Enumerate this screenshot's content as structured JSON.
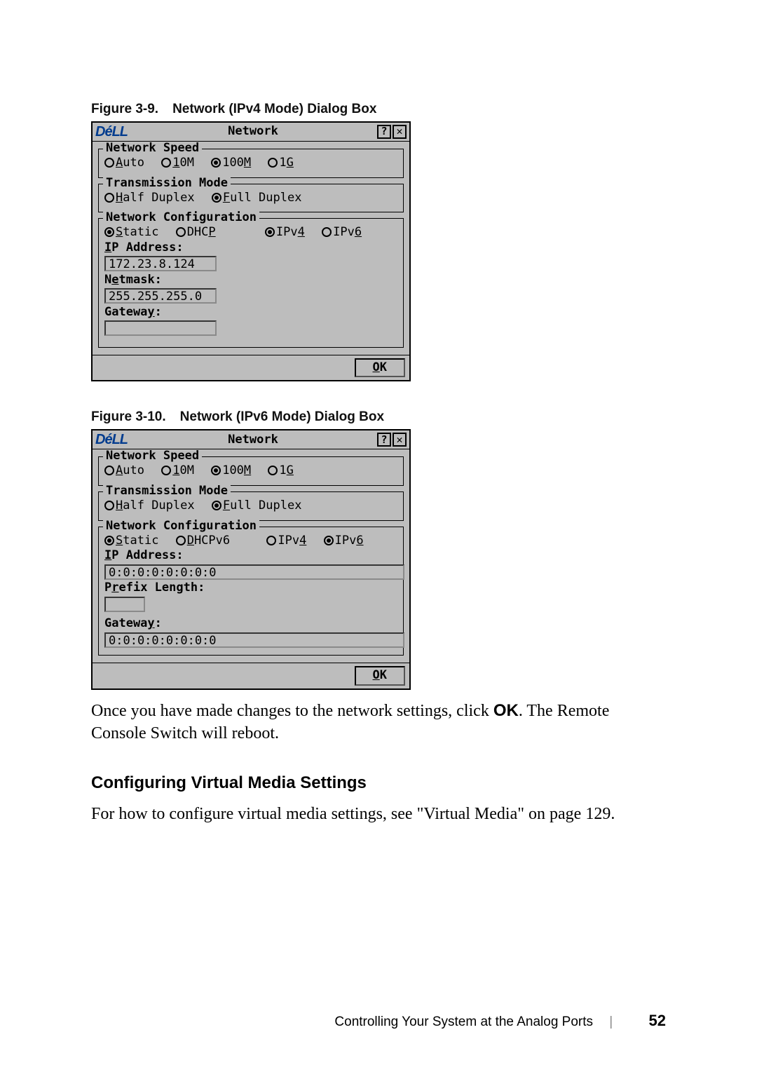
{
  "figure1": {
    "label_prefix": "Figure 3-9.",
    "label_title": "Network (IPv4 Mode) Dialog Box",
    "dialog": {
      "logo": "DéLL",
      "title": "Network",
      "help": "?",
      "close": "✕",
      "speed_legend": "Network Speed",
      "speed_auto": "Auto",
      "speed_10m": "10M",
      "speed_100m": "100M",
      "speed_1g": "1G",
      "trans_legend": "Transmission Mode",
      "half": "Half Duplex",
      "full": "Full Duplex",
      "config_legend": "Network Configuration",
      "static": "Static",
      "dhcp": "DHCP",
      "ipv4": "IPv4",
      "ipv6": "IPv6",
      "ip_label": "IP Address:",
      "ip_value": "172.23.8.124",
      "netmask_label": "Netmask:",
      "netmask_value": "255.255.255.0",
      "gateway_label": "Gateway:",
      "gateway_value": "",
      "ok": "OK"
    }
  },
  "figure2": {
    "label_prefix": "Figure 3-10.",
    "label_title": "Network (IPv6 Mode) Dialog Box",
    "dialog": {
      "logo": "DéLL",
      "title": "Network",
      "help": "?",
      "close": "✕",
      "speed_legend": "Network Speed",
      "speed_auto": "Auto",
      "speed_10m": "10M",
      "speed_100m": "100M",
      "speed_1g": "1G",
      "trans_legend": "Transmission Mode",
      "half": "Half Duplex",
      "full": "Full Duplex",
      "config_legend": "Network Configuration",
      "static": "Static",
      "dhcp": "DHCPv6",
      "ipv4": "IPv4",
      "ipv6": "IPv6",
      "ip_label": "IP Address:",
      "ip_value": "0:0:0:0:0:0:0:0",
      "prefix_label": "Prefix Length:",
      "prefix_value": "",
      "gateway_label": "Gateway:",
      "gateway_value": "0:0:0:0:0:0:0:0",
      "ok": "OK"
    }
  },
  "body_para_1a": "Once you have made changes to the network settings, click ",
  "body_para_1b": "OK",
  "body_para_1c": ". The Remote Console Switch will reboot.",
  "section_heading": "Configuring Virtual Media Settings",
  "body_para_2": "For how to configure virtual media settings, see \"Virtual Media\" on page 129.",
  "footer_text": "Controlling Your System at the Analog Ports",
  "footer_page": "52"
}
